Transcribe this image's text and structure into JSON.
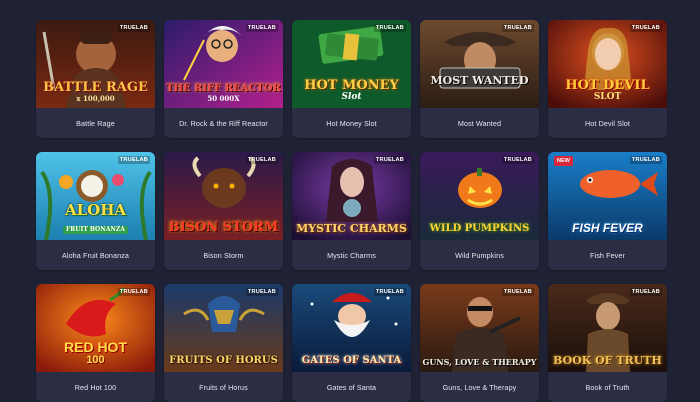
{
  "provider_badge": "TRUELAB",
  "new_badge": "NEW",
  "games": [
    {
      "title": "Battle Rage",
      "logo": "BATTLE RAGE",
      "sub": "x 100,000"
    },
    {
      "title": "Dr. Rock & the Riff Reactor",
      "logo": "THE RIFF REACTOR",
      "sub": "50 000X"
    },
    {
      "title": "Hot Money Slot",
      "logo": "HOT MONEY",
      "sub": "Slot"
    },
    {
      "title": "Most Wanted",
      "logo": "MOST WANTED",
      "sub": ""
    },
    {
      "title": "Hot Devil Slot",
      "logo": "HOT DEVIL",
      "sub": "SLOT"
    },
    {
      "title": "Aloha Fruit Bonanza",
      "logo": "ALOHA",
      "sub": "FRUIT BONANZA"
    },
    {
      "title": "Bison Storm",
      "logo": "BISON STORM",
      "sub": ""
    },
    {
      "title": "Mystic Charms",
      "logo": "MYSTIC CHARMS",
      "sub": ""
    },
    {
      "title": "Wild Pumpkins",
      "logo": "WILD PUMPKINS",
      "sub": ""
    },
    {
      "title": "Fish Fever",
      "logo": "FISH FEVER",
      "sub": ""
    },
    {
      "title": "Red Hot 100",
      "logo": "RED HOT",
      "sub": "100"
    },
    {
      "title": "Fruits of Horus",
      "logo": "FRUITS OF HORUS",
      "sub": ""
    },
    {
      "title": "Gates of Santa",
      "logo": "GATES OF SANTA",
      "sub": ""
    },
    {
      "title": "Guns, Love & Therapy",
      "logo": "GUNS, LOVE & THERAPY",
      "sub": ""
    },
    {
      "title": "Book of Truth",
      "logo": "BOOK OF TRUTH",
      "sub": ""
    }
  ]
}
